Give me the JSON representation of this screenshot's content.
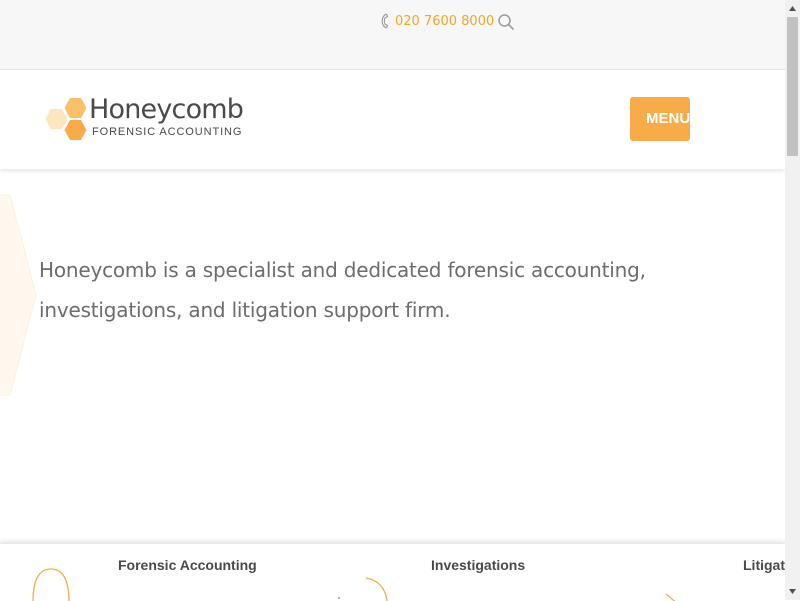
{
  "topbar": {
    "phone_number": "020 7600 8000",
    "phone_icon": "phone-icon",
    "search_icon": "search-icon"
  },
  "header": {
    "logo_name": "Honeycomb",
    "logo_subtitle": "FORENSIC ACCOUNTING",
    "menu_label": "MENU"
  },
  "hero": {
    "intro": "Honeycomb is a specialist and dedicated forensic accounting, investigations, and litigation support firm."
  },
  "services": [
    {
      "title": "Forensic Accounting"
    },
    {
      "title": "Investigations"
    },
    {
      "title": "Litigation"
    }
  ],
  "colors": {
    "accent": "#f7ab49",
    "accent_light": "#fbd9a6",
    "text_dark": "#4a4a4a",
    "text_body": "#6d6d6d"
  }
}
